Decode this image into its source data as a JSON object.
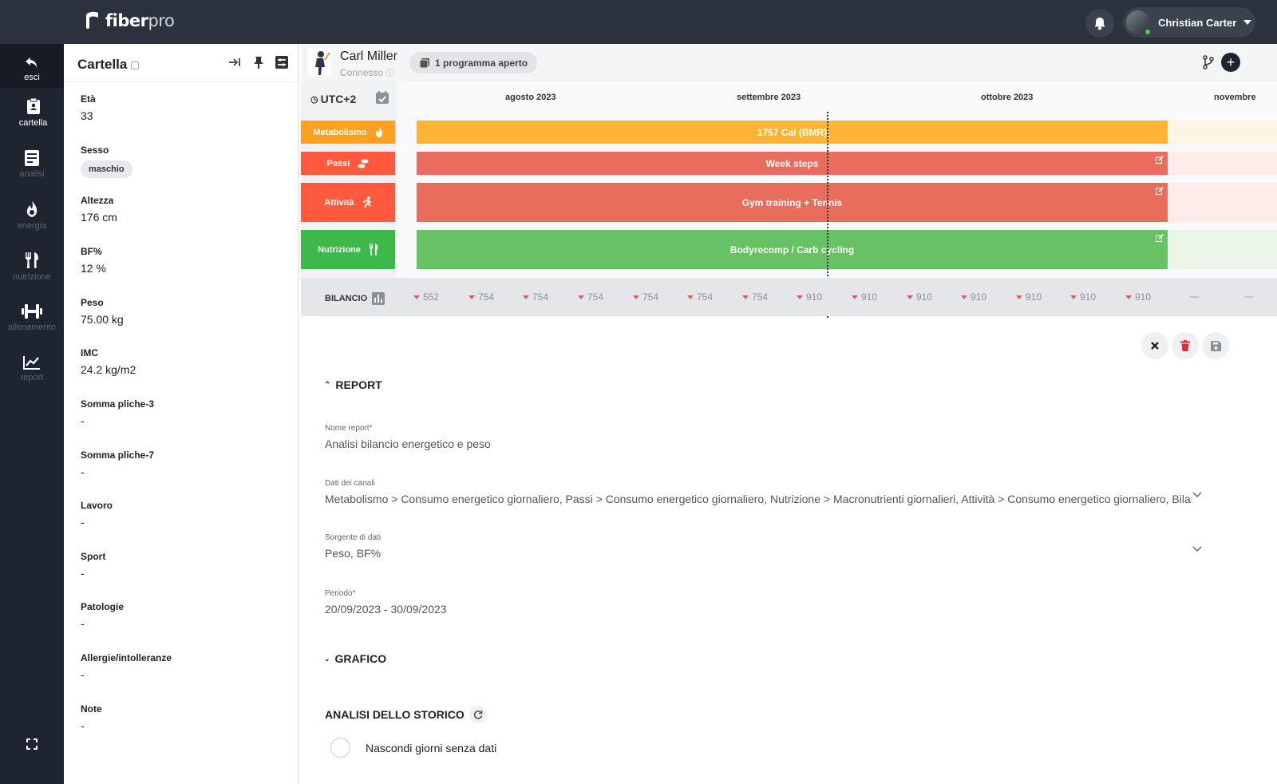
{
  "app": {
    "brand_a": "fiber",
    "brand_b": "pro",
    "user_name": "Christian Carter"
  },
  "nav": {
    "items": [
      {
        "label": "esci",
        "icon": "undo-arrow-icon"
      },
      {
        "label": "cartella",
        "icon": "clipboard-icon"
      },
      {
        "label": "analisi",
        "icon": "document-list-icon"
      },
      {
        "label": "energia",
        "icon": "flame-icon"
      },
      {
        "label": "nutrizione",
        "icon": "fork-knife-icon"
      },
      {
        "label": "allenamento",
        "icon": "dumbbell-icon"
      },
      {
        "label": "report",
        "icon": "line-chart-icon"
      }
    ]
  },
  "profile": {
    "title": "Cartella",
    "fields": [
      {
        "label": "Età",
        "value": "33"
      },
      {
        "label": "Sesso",
        "value": "maschio"
      },
      {
        "label": "Altezza",
        "value": "176 cm"
      },
      {
        "label": "BF%",
        "value": "12 %"
      },
      {
        "label": "Peso",
        "value": "75.00 kg"
      },
      {
        "label": "IMC",
        "value": "24.2 kg/m2"
      },
      {
        "label": "Somma pliche-3",
        "value": "-"
      },
      {
        "label": "Somma pliche-7",
        "value": "-"
      },
      {
        "label": "Lavoro",
        "value": "-"
      },
      {
        "label": "Sport",
        "value": "-"
      },
      {
        "label": "Patologie",
        "value": "-"
      },
      {
        "label": "Allergie/intolleranze",
        "value": "-"
      },
      {
        "label": "Note",
        "value": "-"
      }
    ]
  },
  "patient": {
    "name": "Carl Miller",
    "status": "Connesso",
    "programs": "1 programma aperto"
  },
  "timeline": {
    "timezone": "UTC+2",
    "months": [
      "agosto 2023",
      "settembre 2023",
      "ottobre 2023",
      "novembre"
    ],
    "channels": [
      {
        "name": "Metabolismo",
        "bar": "1757 Cal (BMR)",
        "color": "#ffa020",
        "bar_color": "#ffb533",
        "editable": false
      },
      {
        "name": "Passi",
        "bar": "Week steps",
        "color": "#ff5a3d",
        "bar_color": "#e86d5d",
        "editable": true
      },
      {
        "name": "Attività",
        "bar": "Gym training + Tennis",
        "color": "#ff5a3d",
        "bar_color": "#e86d5d",
        "editable": true
      },
      {
        "name": "Nutrizione",
        "bar": "Bodyrecomp / Carb cycling",
        "color": "#3db84a",
        "bar_color": "#66c262",
        "editable": true
      }
    ],
    "balance_label": "BILANCIO",
    "balance_values": [
      "552",
      "754",
      "754",
      "754",
      "754",
      "754",
      "754",
      "910",
      "910",
      "910",
      "910",
      "910",
      "910",
      "910"
    ]
  },
  "report": {
    "section_title": "REPORT",
    "name_label": "Nome report*",
    "name_value": "Analisi bilancio energetico e peso",
    "channels_label": "Dati dei canali",
    "channels_value": "Metabolismo > Consumo energetico giornaliero, Passi > Consumo energetico giornaliero, Nutrizione > Macronutrienti giornalieri, Attività > Consumo energetico giornaliero, Bilancio",
    "source_label": "Sorgente di dati",
    "source_value": "Peso, BF%",
    "period_label": "Periodo*",
    "period_value": "20/09/2023 - 30/09/2023",
    "chart_title": "GRAFICO",
    "history_title": "ANALISI DELLO STORICO",
    "hide_days_label": "Nascondi giorni senza dati"
  }
}
